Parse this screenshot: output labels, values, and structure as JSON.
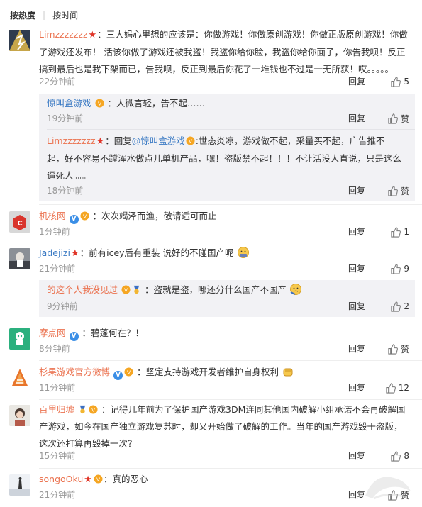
{
  "sort": {
    "hot": "按热度",
    "time": "按时间"
  },
  "ui": {
    "reply": "回复",
    "like": "赞"
  },
  "comments": [
    {
      "user": "Limzzzzzzz",
      "sep": "：",
      "text": "三大妈心里想的应该是：你做游戏！你做原创游戏！你做正版原创游戏！你做了游戏还发布！ 活该你做了游戏还被我盗！我盗你给你脸，我盗你给你面子，你告我呗！反正搞到最后也是我下架而已，告我呗，反正到最后你花了一堆钱也不过是一无所获！哎。。。。。",
      "time": "22分钟前",
      "likes": "5",
      "replies": [
        {
          "user": "惊叫盒游戏",
          "sep": "：",
          "text": "人微言轻，告不起……",
          "time": "19分钟前",
          "likes": "赞"
        },
        {
          "user": "Limzzzzzzz",
          "sep": "：",
          "reply_prefix": "回复",
          "mention": "@惊叫盒游戏",
          "text": ":世态炎凉，游戏做不起，采量买不起，广告推不起，好不容易不蹚浑水做点儿单机产品，嘿！盗版禁不起！！！不让活没人直说，只是这么逼死人。。。",
          "time": "18分钟前",
          "likes": "赞"
        }
      ]
    },
    {
      "user": "机核网",
      "sep": "：",
      "text": "次次竭泽而渔，敬请适可而止",
      "time": "1分钟前",
      "likes": "1"
    },
    {
      "user": "Jadejizi",
      "sep": "：",
      "text": "前有icey后有重装 说好的不碰国产呢",
      "time": "21分钟前",
      "likes": "9",
      "replies": [
        {
          "user": "的这个人我没见过",
          "sep": "：",
          "text": "盗就是盗，哪还分什么国产不国产",
          "time": "9分钟前",
          "likes": "2"
        }
      ]
    },
    {
      "user": "摩点网",
      "sep": "：",
      "text": "碧蓬何在？！",
      "time": "8分钟前",
      "likes": "赞"
    },
    {
      "user": "杉果游戏官方微博",
      "sep": "：",
      "text": "坚定支持游戏开发者维护自身权利",
      "time": "11分钟前",
      "likes": "12"
    },
    {
      "user": "百里归墟",
      "sep": "：",
      "text": "记得几年前为了保护国产游戏3DM连同其他国内破解小组承诺不会再破解国产游戏，如今在国产独立游戏复苏时，却又开始做了破解的工作。当年的国产游戏毁于盗版，这次还打算再毁掉一次？",
      "time": "15分钟前",
      "likes": "8"
    },
    {
      "user": "songoOku",
      "sep": "：",
      "text": "真的恶心",
      "time": "21分钟前",
      "likes": "赞"
    }
  ],
  "colors": {
    "username": "#eb7350",
    "text": "#333333",
    "meta": "#999999",
    "subbox": "#f2f2f5"
  }
}
